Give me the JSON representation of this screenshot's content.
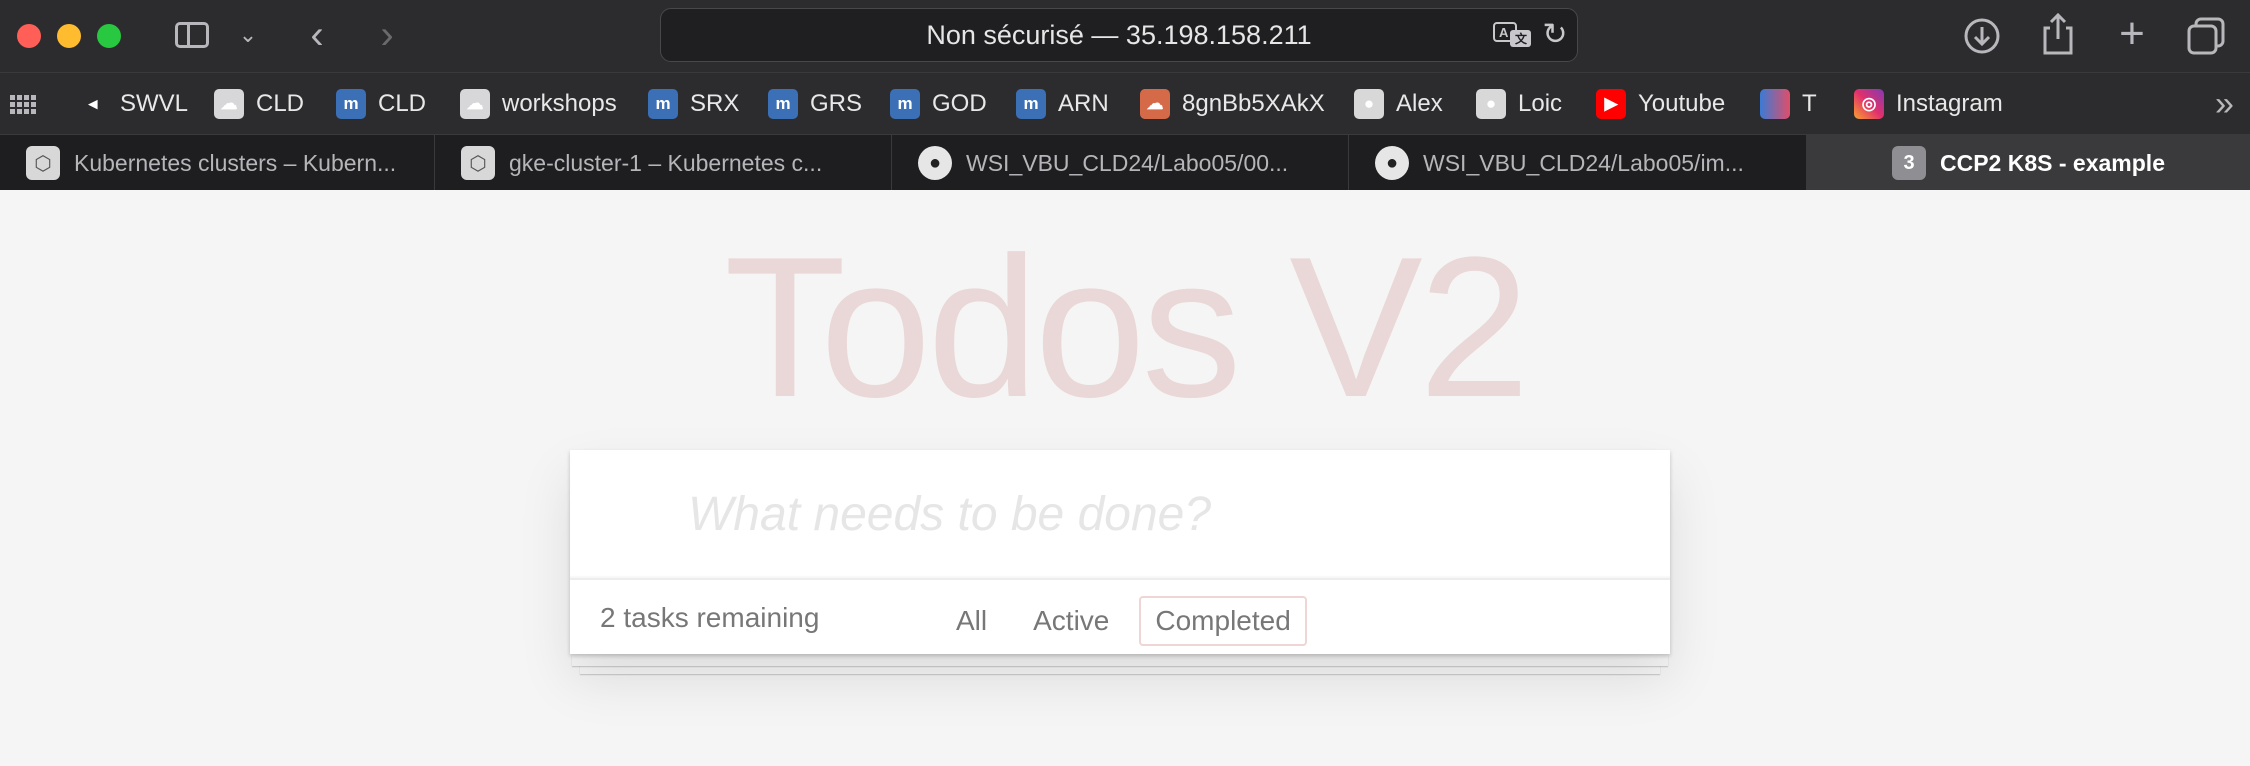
{
  "browser": {
    "address": "Non sécurisé — 35.198.158.211",
    "translate_icon": "translate-icon",
    "reload_glyph": "↻",
    "favorites": [
      {
        "label": "SWVL",
        "icon": "swvl-icon",
        "glyph": "◂"
      },
      {
        "label": "CLD",
        "icon": "cloud-icon",
        "glyph": "☁"
      },
      {
        "label": "CLD",
        "icon": "moodle-icon",
        "glyph": "m"
      },
      {
        "label": "workshops",
        "icon": "cloud-icon",
        "glyph": "☁"
      },
      {
        "label": "SRX",
        "icon": "moodle-icon",
        "glyph": "m"
      },
      {
        "label": "GRS",
        "icon": "moodle-icon",
        "glyph": "m"
      },
      {
        "label": "GOD",
        "icon": "moodle-icon",
        "glyph": "m"
      },
      {
        "label": "ARN",
        "icon": "moodle-icon",
        "glyph": "m"
      },
      {
        "label": "8gnBb5XAkX",
        "icon": "anon-icon",
        "glyph": "☁"
      },
      {
        "label": "Alex",
        "icon": "github-icon",
        "glyph": "●"
      },
      {
        "label": "Loic",
        "icon": "github-icon",
        "glyph": "●"
      },
      {
        "label": "Youtube",
        "icon": "youtube-icon",
        "glyph": "▶"
      },
      {
        "label": "T",
        "icon": "t-icon",
        "glyph": ""
      },
      {
        "label": "Instagram",
        "icon": "instagram-icon",
        "glyph": "◎"
      }
    ],
    "tabs": [
      {
        "title": "Kubernetes clusters – Kubern...",
        "icon": "gke-icon",
        "glyph": "⬡"
      },
      {
        "title": "gke-cluster-1 – Kubernetes c...",
        "icon": "gke-icon",
        "glyph": "⬡"
      },
      {
        "title": "WSI_VBU_CLD24/Labo05/00...",
        "icon": "github-icon",
        "glyph": "●"
      },
      {
        "title": "WSI_VBU_CLD24/Labo05/im...",
        "icon": "github-icon",
        "glyph": "●"
      },
      {
        "title": "CCP2 K8S - example",
        "icon": "tab-group-badge",
        "glyph": "3"
      }
    ]
  },
  "app": {
    "title": "Todos V2",
    "new_todo_placeholder": "What needs to be done?",
    "remaining": "2 tasks remaining",
    "filters": [
      "All",
      "Active",
      "Completed"
    ],
    "selected_filter": "Completed"
  },
  "colors": {
    "title": "#af2f2f",
    "chrome_bg": "#2c2c2e",
    "active_tab": "#3a3a3c"
  }
}
